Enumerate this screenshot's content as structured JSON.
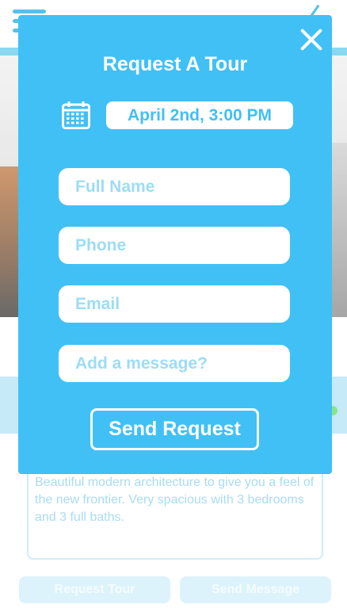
{
  "modal": {
    "title": "Request A Tour",
    "date_time": "April 2nd, 3:00 PM",
    "fields": {
      "full_name_placeholder": "Full Name",
      "phone_placeholder": "Phone",
      "email_placeholder": "Email",
      "message_placeholder": "Add a message?"
    },
    "submit_label": "Send Request",
    "icons": {
      "close": "close-icon",
      "calendar": "calendar-icon"
    }
  },
  "background": {
    "description": "Beautiful modern architecture to give you a feel of the new frontier. Very spacious with 3 bedrooms and 3 full baths.",
    "request_tour_label": "Request Tour",
    "send_message_label": "Send Message",
    "icons": {
      "menu": "hamburger-menu-icon",
      "back": "back-icon"
    }
  },
  "colors": {
    "accent": "#41c0f5",
    "placeholder": "#9ddcf6",
    "white": "#ffffff"
  }
}
